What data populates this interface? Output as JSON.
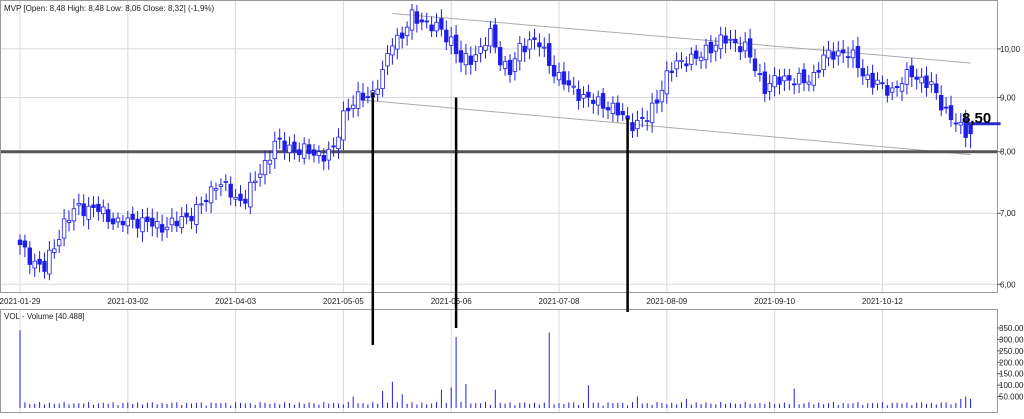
{
  "price_panel": {
    "header": "MVP [Open: 8,48  High: 8,48  Low: 8,06  Close: 8,32] (-1,9%)"
  },
  "volume_panel": {
    "header": "VOL - Volume [40.488]"
  },
  "annotation": {
    "last_price": "8,50"
  },
  "colors": {
    "candle": "#1e1ee6",
    "grid": "#d8d8d8",
    "trend": "#aaaaaa",
    "support": "#555555",
    "annotation": "#000000",
    "marker": "#2a2ad0"
  },
  "chart_data": [
    {
      "type": "candlestick",
      "title": "MVP",
      "y_scale": "log",
      "ylim": [
        5.9,
        11.0
      ],
      "y_ticks": [
        6,
        7,
        8,
        9,
        10
      ],
      "y_tick_labels": [
        "6,00",
        "7,00",
        "8,00",
        "9,00",
        "10,00"
      ],
      "x_labels": [
        "2021-01-29",
        "2021-03-02",
        "2021-04-03",
        "2021-05-05",
        "2021-06-06",
        "2021-07-08",
        "2021-08-09",
        "2021-09-10",
        "2021-10-12"
      ],
      "x_label_index": [
        0,
        22,
        44,
        66,
        88,
        110,
        132,
        154,
        176
      ],
      "n_bars": 195,
      "close_anchors": [
        [
          0,
          6.5
        ],
        [
          3,
          6.3
        ],
        [
          5,
          6.2
        ],
        [
          9,
          6.85
        ],
        [
          12,
          7.1
        ],
        [
          16,
          7.05
        ],
        [
          20,
          6.85
        ],
        [
          24,
          6.9
        ],
        [
          28,
          6.8
        ],
        [
          32,
          6.85
        ],
        [
          36,
          7.05
        ],
        [
          38,
          7.2
        ],
        [
          40,
          7.5
        ],
        [
          42,
          7.4
        ],
        [
          44,
          7.2
        ],
        [
          46,
          7.25
        ],
        [
          48,
          7.5
        ],
        [
          50,
          7.8
        ],
        [
          52,
          8.15
        ],
        [
          54,
          8.1
        ],
        [
          56,
          8.05
        ],
        [
          58,
          8.0
        ],
        [
          62,
          7.95
        ],
        [
          64,
          8.0
        ],
        [
          66,
          8.7
        ],
        [
          68,
          8.9
        ],
        [
          70,
          9.0
        ],
        [
          72,
          9.1
        ],
        [
          74,
          9.45
        ],
        [
          76,
          10.2
        ],
        [
          78,
          10.3
        ],
        [
          80,
          10.7
        ],
        [
          82,
          10.65
        ],
        [
          84,
          10.5
        ],
        [
          86,
          10.4
        ],
        [
          88,
          10.2
        ],
        [
          90,
          9.7
        ],
        [
          92,
          9.8
        ],
        [
          94,
          10.0
        ],
        [
          96,
          10.3
        ],
        [
          98,
          9.8
        ],
        [
          100,
          9.5
        ],
        [
          102,
          10.0
        ],
        [
          104,
          10.2
        ],
        [
          106,
          10.1
        ],
        [
          108,
          9.7
        ],
        [
          110,
          9.4
        ],
        [
          112,
          9.2
        ],
        [
          114,
          9.1
        ],
        [
          116,
          8.95
        ],
        [
          118,
          8.9
        ],
        [
          120,
          8.85
        ],
        [
          122,
          8.7
        ],
        [
          124,
          8.55
        ],
        [
          126,
          8.5
        ],
        [
          128,
          8.6
        ],
        [
          130,
          9.0
        ],
        [
          132,
          9.4
        ],
        [
          134,
          9.7
        ],
        [
          136,
          9.8
        ],
        [
          138,
          9.75
        ],
        [
          140,
          10.0
        ],
        [
          142,
          10.1
        ],
        [
          144,
          10.2
        ],
        [
          146,
          10.15
        ],
        [
          148,
          10.0
        ],
        [
          150,
          9.6
        ],
        [
          152,
          9.2
        ],
        [
          154,
          9.3
        ],
        [
          156,
          9.4
        ],
        [
          158,
          9.35
        ],
        [
          160,
          9.3
        ],
        [
          162,
          9.45
        ],
        [
          164,
          9.8
        ],
        [
          166,
          9.9
        ],
        [
          168,
          9.95
        ],
        [
          170,
          9.8
        ],
        [
          172,
          9.5
        ],
        [
          174,
          9.3
        ],
        [
          176,
          9.2
        ],
        [
          178,
          9.15
        ],
        [
          180,
          9.3
        ],
        [
          182,
          9.5
        ],
        [
          184,
          9.35
        ],
        [
          186,
          9.2
        ],
        [
          188,
          8.9
        ],
        [
          190,
          8.6
        ],
        [
          192,
          8.4
        ],
        [
          194,
          8.32
        ]
      ],
      "last_bar": {
        "open": 8.48,
        "high": 8.48,
        "low": 8.06,
        "close": 8.32
      },
      "support_level": 8.0,
      "channel": {
        "upper": [
          [
            76,
            10.8
          ],
          [
            194,
            9.7
          ]
        ],
        "lower": [
          [
            70,
            8.95
          ],
          [
            194,
            7.95
          ]
        ]
      }
    },
    {
      "type": "bar",
      "title": "VOL - Volume",
      "ylim": [
        0,
        420000
      ],
      "y_ticks": [
        50000,
        100000,
        150000,
        200000,
        250000,
        300000,
        350000
      ],
      "y_tick_labels": [
        "50.000",
        "100.000",
        "150.000",
        "200.000",
        "250.000",
        "300.000",
        "350.000"
      ],
      "base_volume": 15000,
      "spikes": [
        [
          0,
          340000
        ],
        [
          68,
          50000
        ],
        [
          74,
          75000
        ],
        [
          76,
          115000
        ],
        [
          78,
          60000
        ],
        [
          86,
          80000
        ],
        [
          88,
          90000
        ],
        [
          89,
          310000
        ],
        [
          91,
          105000
        ],
        [
          97,
          80000
        ],
        [
          108,
          330000
        ],
        [
          116,
          100000
        ],
        [
          126,
          50000
        ],
        [
          136,
          40000
        ],
        [
          158,
          85000
        ],
        [
          192,
          40000
        ],
        [
          193,
          50000
        ],
        [
          194,
          40488
        ]
      ],
      "last_value": 40488
    }
  ]
}
